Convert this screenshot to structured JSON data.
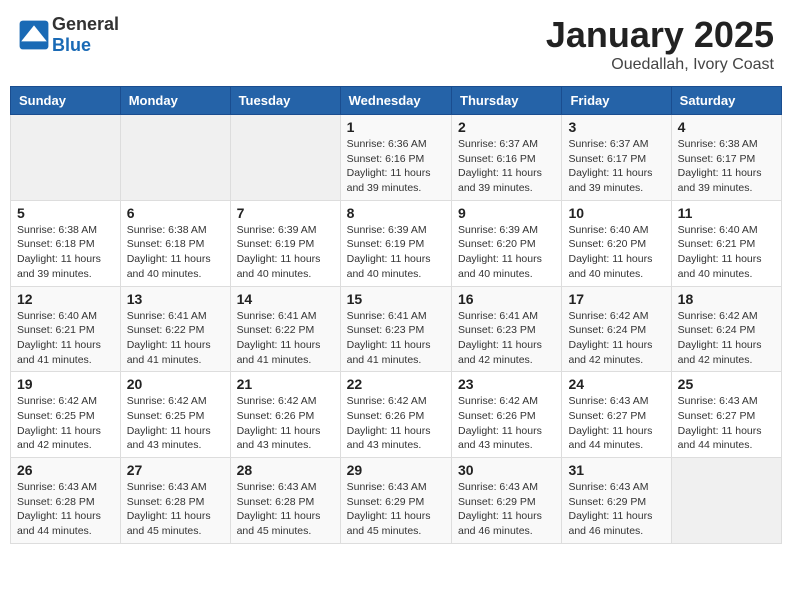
{
  "header": {
    "logo_general": "General",
    "logo_blue": "Blue",
    "month_title": "January 2025",
    "location": "Ouedallah, Ivory Coast"
  },
  "weekdays": [
    "Sunday",
    "Monday",
    "Tuesday",
    "Wednesday",
    "Thursday",
    "Friday",
    "Saturday"
  ],
  "weeks": [
    [
      {
        "day": "",
        "info": ""
      },
      {
        "day": "",
        "info": ""
      },
      {
        "day": "",
        "info": ""
      },
      {
        "day": "1",
        "info": "Sunrise: 6:36 AM\nSunset: 6:16 PM\nDaylight: 11 hours and 39 minutes."
      },
      {
        "day": "2",
        "info": "Sunrise: 6:37 AM\nSunset: 6:16 PM\nDaylight: 11 hours and 39 minutes."
      },
      {
        "day": "3",
        "info": "Sunrise: 6:37 AM\nSunset: 6:17 PM\nDaylight: 11 hours and 39 minutes."
      },
      {
        "day": "4",
        "info": "Sunrise: 6:38 AM\nSunset: 6:17 PM\nDaylight: 11 hours and 39 minutes."
      }
    ],
    [
      {
        "day": "5",
        "info": "Sunrise: 6:38 AM\nSunset: 6:18 PM\nDaylight: 11 hours and 39 minutes."
      },
      {
        "day": "6",
        "info": "Sunrise: 6:38 AM\nSunset: 6:18 PM\nDaylight: 11 hours and 40 minutes."
      },
      {
        "day": "7",
        "info": "Sunrise: 6:39 AM\nSunset: 6:19 PM\nDaylight: 11 hours and 40 minutes."
      },
      {
        "day": "8",
        "info": "Sunrise: 6:39 AM\nSunset: 6:19 PM\nDaylight: 11 hours and 40 minutes."
      },
      {
        "day": "9",
        "info": "Sunrise: 6:39 AM\nSunset: 6:20 PM\nDaylight: 11 hours and 40 minutes."
      },
      {
        "day": "10",
        "info": "Sunrise: 6:40 AM\nSunset: 6:20 PM\nDaylight: 11 hours and 40 minutes."
      },
      {
        "day": "11",
        "info": "Sunrise: 6:40 AM\nSunset: 6:21 PM\nDaylight: 11 hours and 40 minutes."
      }
    ],
    [
      {
        "day": "12",
        "info": "Sunrise: 6:40 AM\nSunset: 6:21 PM\nDaylight: 11 hours and 41 minutes."
      },
      {
        "day": "13",
        "info": "Sunrise: 6:41 AM\nSunset: 6:22 PM\nDaylight: 11 hours and 41 minutes."
      },
      {
        "day": "14",
        "info": "Sunrise: 6:41 AM\nSunset: 6:22 PM\nDaylight: 11 hours and 41 minutes."
      },
      {
        "day": "15",
        "info": "Sunrise: 6:41 AM\nSunset: 6:23 PM\nDaylight: 11 hours and 41 minutes."
      },
      {
        "day": "16",
        "info": "Sunrise: 6:41 AM\nSunset: 6:23 PM\nDaylight: 11 hours and 42 minutes."
      },
      {
        "day": "17",
        "info": "Sunrise: 6:42 AM\nSunset: 6:24 PM\nDaylight: 11 hours and 42 minutes."
      },
      {
        "day": "18",
        "info": "Sunrise: 6:42 AM\nSunset: 6:24 PM\nDaylight: 11 hours and 42 minutes."
      }
    ],
    [
      {
        "day": "19",
        "info": "Sunrise: 6:42 AM\nSunset: 6:25 PM\nDaylight: 11 hours and 42 minutes."
      },
      {
        "day": "20",
        "info": "Sunrise: 6:42 AM\nSunset: 6:25 PM\nDaylight: 11 hours and 43 minutes."
      },
      {
        "day": "21",
        "info": "Sunrise: 6:42 AM\nSunset: 6:26 PM\nDaylight: 11 hours and 43 minutes."
      },
      {
        "day": "22",
        "info": "Sunrise: 6:42 AM\nSunset: 6:26 PM\nDaylight: 11 hours and 43 minutes."
      },
      {
        "day": "23",
        "info": "Sunrise: 6:42 AM\nSunset: 6:26 PM\nDaylight: 11 hours and 43 minutes."
      },
      {
        "day": "24",
        "info": "Sunrise: 6:43 AM\nSunset: 6:27 PM\nDaylight: 11 hours and 44 minutes."
      },
      {
        "day": "25",
        "info": "Sunrise: 6:43 AM\nSunset: 6:27 PM\nDaylight: 11 hours and 44 minutes."
      }
    ],
    [
      {
        "day": "26",
        "info": "Sunrise: 6:43 AM\nSunset: 6:28 PM\nDaylight: 11 hours and 44 minutes."
      },
      {
        "day": "27",
        "info": "Sunrise: 6:43 AM\nSunset: 6:28 PM\nDaylight: 11 hours and 45 minutes."
      },
      {
        "day": "28",
        "info": "Sunrise: 6:43 AM\nSunset: 6:28 PM\nDaylight: 11 hours and 45 minutes."
      },
      {
        "day": "29",
        "info": "Sunrise: 6:43 AM\nSunset: 6:29 PM\nDaylight: 11 hours and 45 minutes."
      },
      {
        "day": "30",
        "info": "Sunrise: 6:43 AM\nSunset: 6:29 PM\nDaylight: 11 hours and 46 minutes."
      },
      {
        "day": "31",
        "info": "Sunrise: 6:43 AM\nSunset: 6:29 PM\nDaylight: 11 hours and 46 minutes."
      },
      {
        "day": "",
        "info": ""
      }
    ]
  ]
}
